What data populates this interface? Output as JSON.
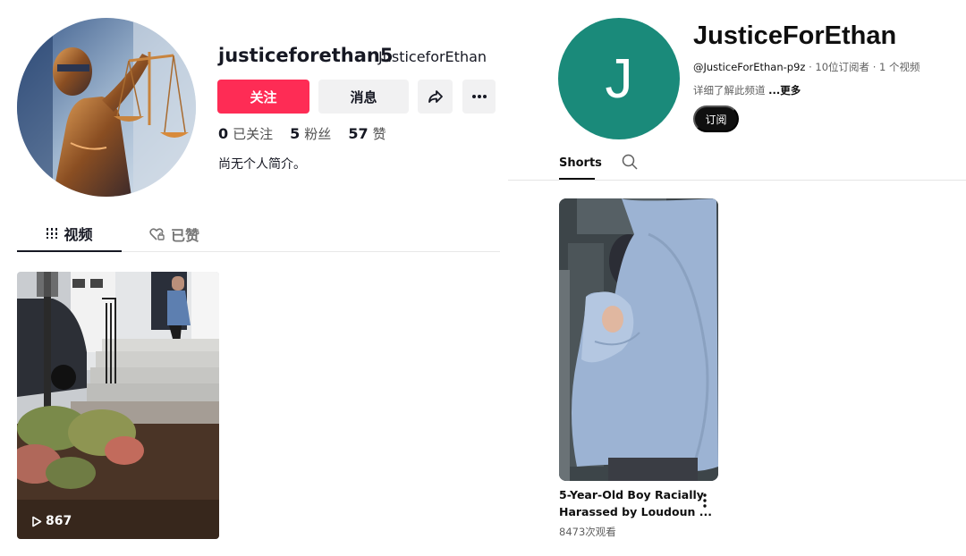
{
  "tiktok": {
    "username": "justiceforethan5",
    "nickname": "JusticeforEthan",
    "buttons": {
      "follow": "关注",
      "message": "消息"
    },
    "stats": [
      {
        "value": "0",
        "label": "已关注"
      },
      {
        "value": "5",
        "label": "粉丝"
      },
      {
        "value": "57",
        "label": "赞"
      }
    ],
    "bio": "尚无个人简介。",
    "tabs": {
      "videos": "视频",
      "liked": "已赞"
    },
    "video": {
      "views": "867"
    },
    "colors": {
      "accent": "#fe2c55"
    },
    "icons": [
      "share-icon",
      "more-icon",
      "grid-icon",
      "heart-lock-icon",
      "play-icon"
    ]
  },
  "youtube": {
    "avatar_letter": "J",
    "channel_name": "JusticeForEthan",
    "handle": "@JusticeForEthan-p9z",
    "subscribers": " · 10位订阅者 · 1 个视频",
    "desc": "详细了解此频道 ",
    "more": "...更多",
    "subscribe": "订阅",
    "tab_shorts": "Shorts",
    "video": {
      "title_line1": "5-Year-Old Boy Racially",
      "title_line2": "Harassed by Loudoun ...",
      "views": "8473次观看"
    },
    "colors": {
      "avatar": "#1a8a7a"
    },
    "icons": [
      "search-icon",
      "more-vertical-icon"
    ]
  }
}
